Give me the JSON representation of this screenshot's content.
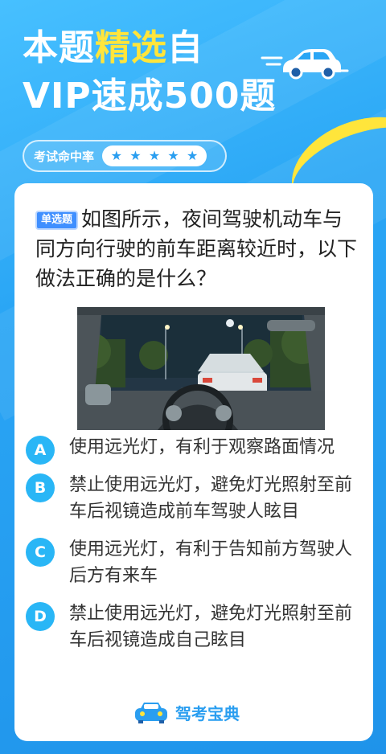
{
  "header": {
    "title_line1_pre": "本题",
    "title_line1_highlight": "精选",
    "title_line1_post": "自",
    "title_line2": "VIP速成500题",
    "car_icon": "car-icon"
  },
  "rating": {
    "label": "考试命中率",
    "stars": 5,
    "star_glyph": "★"
  },
  "question": {
    "type_label": "单选题",
    "text": "如图所示，夜间驾驶机动车与同方向行驶的前车距离较近时，以下做法正确的是什么？"
  },
  "options": [
    {
      "letter": "A",
      "text": "使用远光灯，有利于观察路面情况"
    },
    {
      "letter": "B",
      "text": "禁止使用远光灯，避免灯光照射至前车后视镜造成前车驾驶人眩目"
    },
    {
      "letter": "C",
      "text": "使用远光灯，有利于告知前方驾驶人后方有来车"
    },
    {
      "letter": "D",
      "text": "禁止使用远光灯，避免灯光照射至前车后视镜造成自己眩目"
    }
  ],
  "brand": {
    "name": "驾考宝典",
    "logo_icon": "car-logo-icon"
  },
  "colors": {
    "background": "#29a3f1",
    "highlight": "#ffe53b",
    "badge": "#29b6f6",
    "brand": "#2a9ef0"
  }
}
